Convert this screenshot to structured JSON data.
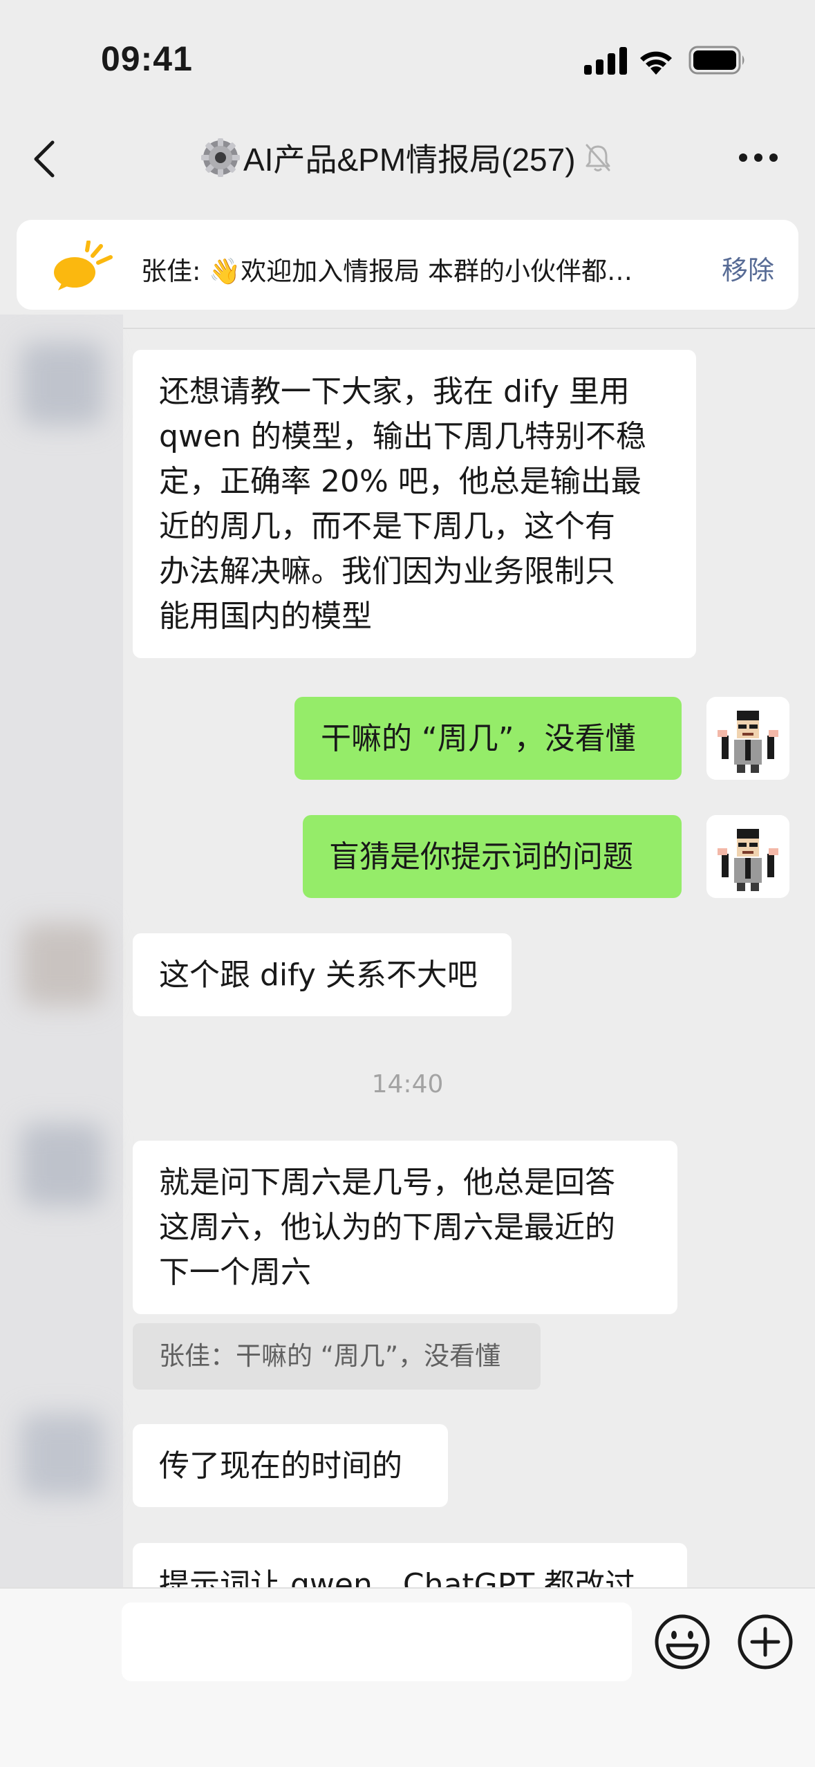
{
  "status_bar": {
    "time": "09:41"
  },
  "header": {
    "title": "AI产品&PM情报局(257)",
    "title_icon": "gear-emoji",
    "muted_icon": "mute-bell-icon"
  },
  "pinned": {
    "text": "张佳: 👋欢迎加入情报局 本群的小伙伴都…",
    "remove_label": "移除"
  },
  "messages": [
    {
      "side": "in",
      "text": "还想请教一下大家，我在 dify 里用\nqwen 的模型，输出下周几特别不稳\n定，正确率 20% 吧，他总是输出最\n近的周几，而不是下周几，这个有\n办法解决嘛。我们因为业务限制只\n能用国内的模型"
    },
    {
      "side": "out",
      "text": "干嘛的 “周几”，没看懂"
    },
    {
      "side": "out",
      "text": "盲猜是你提示词的问题"
    },
    {
      "side": "in",
      "text": "这个跟 dify 关系不大吧"
    },
    {
      "side": "in",
      "text": "就是问下周六是几号，他总是回答\n这周六，他认为的下周六是最近的\n下一个周六"
    },
    {
      "side": "in",
      "text": "传了现在的时间的"
    },
    {
      "side": "in",
      "text": "提示词让 qwen，ChatGPT 都改过"
    }
  ],
  "timestamp": "14:40",
  "quote": "张佳：干嘛的 “周几”，没看懂",
  "input": {
    "value": "",
    "placeholder": ""
  },
  "colors": {
    "background": "#ededed",
    "incoming_bubble": "#ffffff",
    "outgoing_bubble": "#95ec69",
    "link": "#576b95",
    "announcement_icon": "#fbb80f"
  }
}
